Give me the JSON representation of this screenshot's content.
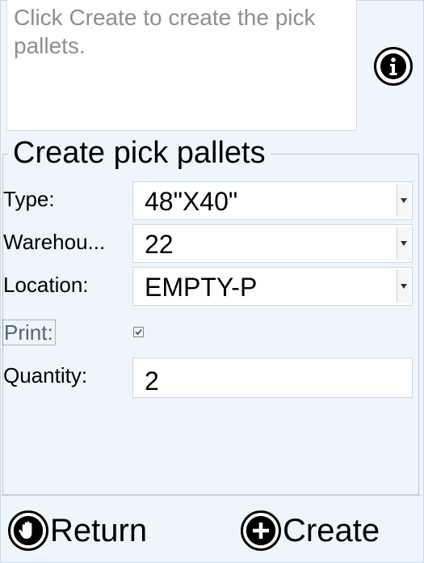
{
  "instructions": "Click Create to create the pick pallets.",
  "group_title": "Create pick pallets",
  "fields": {
    "type": {
      "label": "Type:",
      "value": "48\"X40\""
    },
    "warehouse": {
      "label": "Warehou...",
      "value": "22"
    },
    "location": {
      "label": "Location:",
      "value": "EMPTY-P"
    },
    "print": {
      "label": "Print:",
      "checked": true
    },
    "quantity": {
      "label": "Quantity:",
      "value": "2"
    }
  },
  "buttons": {
    "return_label": "Return",
    "create_label": "Create"
  },
  "icons": {
    "info": "info-icon",
    "dropdown": "chevron-down-icon",
    "return": "hand-stop-icon",
    "create": "plus-circle-icon"
  }
}
